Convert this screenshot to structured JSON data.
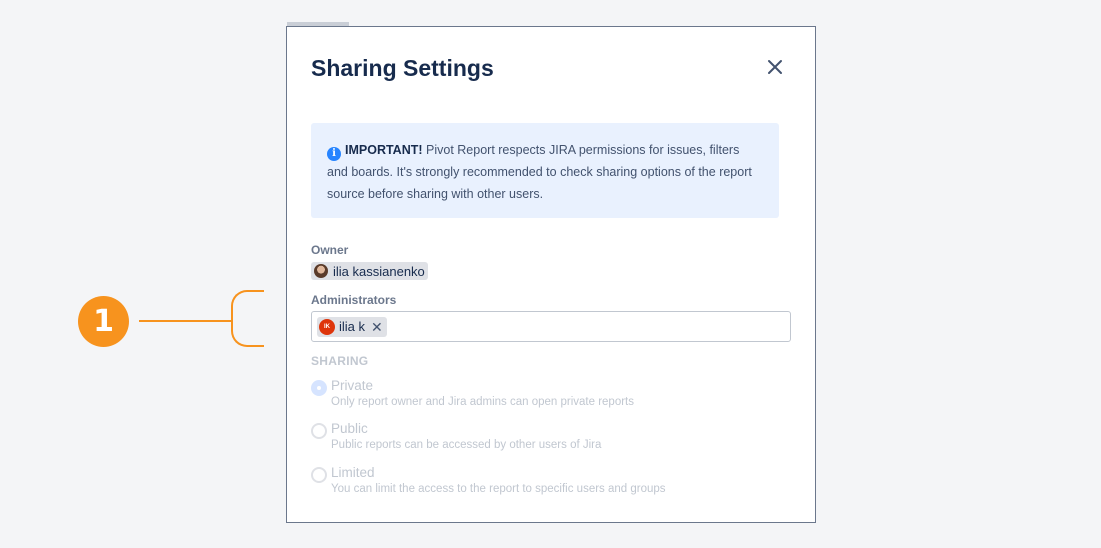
{
  "callout": {
    "number": "1",
    "color": "#f7931e"
  },
  "modal": {
    "title": "Sharing Settings",
    "close_icon": "close-icon",
    "info": {
      "icon": "info-icon",
      "icon_glyph": "i",
      "important": "IMPORTANT!",
      "text": " Pivot Report respects JIRA permissions for issues, filters and boards. It's strongly recommended to check sharing options of the report source before sharing with other users."
    },
    "owner": {
      "label": "Owner",
      "name": "ilia kassianenko"
    },
    "administrators": {
      "label": "Administrators",
      "chips": [
        {
          "initials": "IK",
          "name": "ilia k",
          "remove_glyph": "✕"
        }
      ]
    },
    "sharing": {
      "heading": "SHARING",
      "options": [
        {
          "label": "Private",
          "description": "Only report owner and Jira admins can open private reports",
          "checked": true
        },
        {
          "label": "Public",
          "description": "Public reports can be accessed by other users of Jira",
          "checked": false
        },
        {
          "label": "Limited",
          "description": "You can limit the access to the report to specific users and groups",
          "checked": false
        }
      ]
    }
  },
  "colors": {
    "accent": "#f7931e",
    "info_bg": "#e9f1fe",
    "info_icon": "#2684ff",
    "admin_avatar": "#de350b"
  }
}
